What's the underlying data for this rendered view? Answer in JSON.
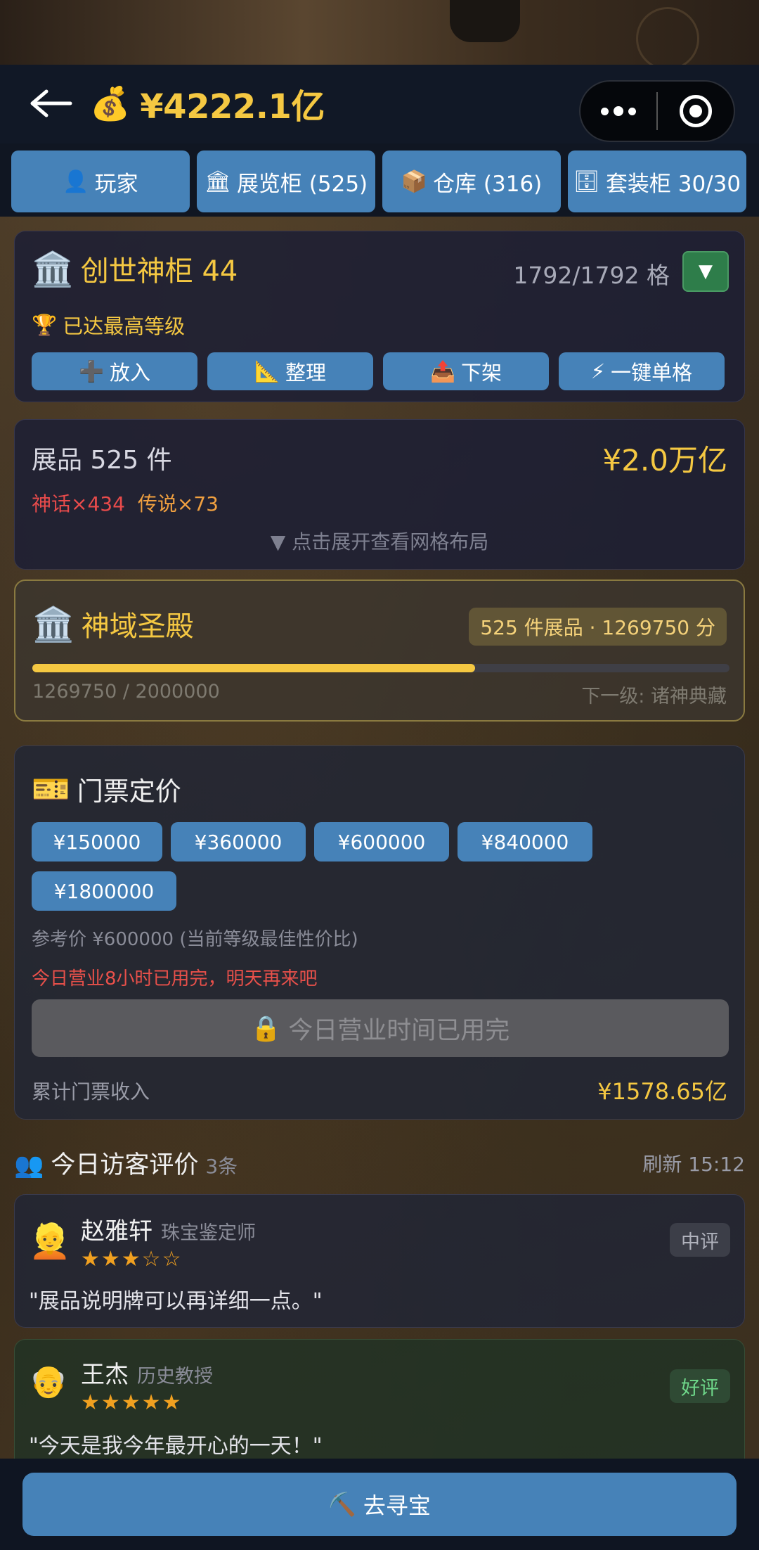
{
  "header": {
    "money_icon": "money-bag-icon",
    "balance": "¥4222.1亿"
  },
  "tabs": [
    {
      "icon": "👤",
      "label": "玩家"
    },
    {
      "icon": "🏛",
      "label": "展览柜 (525)"
    },
    {
      "icon": "📦",
      "label": "仓库 (316)"
    },
    {
      "icon": "🗄",
      "label": "套装柜 30/30"
    }
  ],
  "cabinet": {
    "icon": "🏛️",
    "title": "创世神柜 44",
    "capacity": "1792/1792 格",
    "level_icon": "🏆",
    "level_text": "已达最高等级",
    "actions": [
      {
        "icon": "➕",
        "label": "放入"
      },
      {
        "icon": "📐",
        "label": "整理"
      },
      {
        "icon": "📤",
        "label": "下架"
      },
      {
        "icon": "⚡",
        "label": "一键单格"
      }
    ]
  },
  "exhibits": {
    "count_label": "展品 525 件",
    "total_value": "¥2.0万亿",
    "myth": "神话×434",
    "legend": "传说×73",
    "expand_hint": "▼ 点击展开查看网格布局"
  },
  "museum": {
    "icon": "🏛️",
    "name": "神域圣殿",
    "badge": "525 件展品 · 1269750 分",
    "progress_text": "1269750 / 2000000",
    "progress": 0.634875,
    "next_level": "下一级: 诸神典藏"
  },
  "ticket": {
    "icon": "🎫",
    "title": "门票定价",
    "prices": [
      "¥150000",
      "¥360000",
      "¥600000",
      "¥840000",
      "¥1800000"
    ],
    "reference": "参考价 ¥600000 (当前等级最佳性价比)",
    "warning": "今日营业8小时已用完，明天再来吧",
    "lock_icon": "🔒",
    "disabled_button": "今日营业时间已用完",
    "income_label": "累计门票收入",
    "income_value": "¥1578.65亿"
  },
  "reviews": {
    "icon": "👥",
    "title": "今日访客评价",
    "count": "3条",
    "refresh": "刷新 15:12",
    "items": [
      {
        "avatar": "👱",
        "name": "赵雅轩",
        "role": "珠宝鉴定师",
        "stars": "★★★☆☆",
        "badge": "中评",
        "comment": "\"展品说明牌可以再详细一点。\""
      },
      {
        "avatar": "👴",
        "name": "王杰",
        "role": "历史教授",
        "stars": "★★★★★",
        "badge": "好评",
        "comment": "\"今天是我今年最开心的一天！\""
      }
    ]
  },
  "bottom": {
    "icon": "⛏️",
    "label": "去寻宝"
  },
  "colors": {
    "accent_blue": "#4682b8",
    "gold": "#f5c842",
    "myth_red": "#e84b4b",
    "legend_orange": "#f0a040"
  }
}
